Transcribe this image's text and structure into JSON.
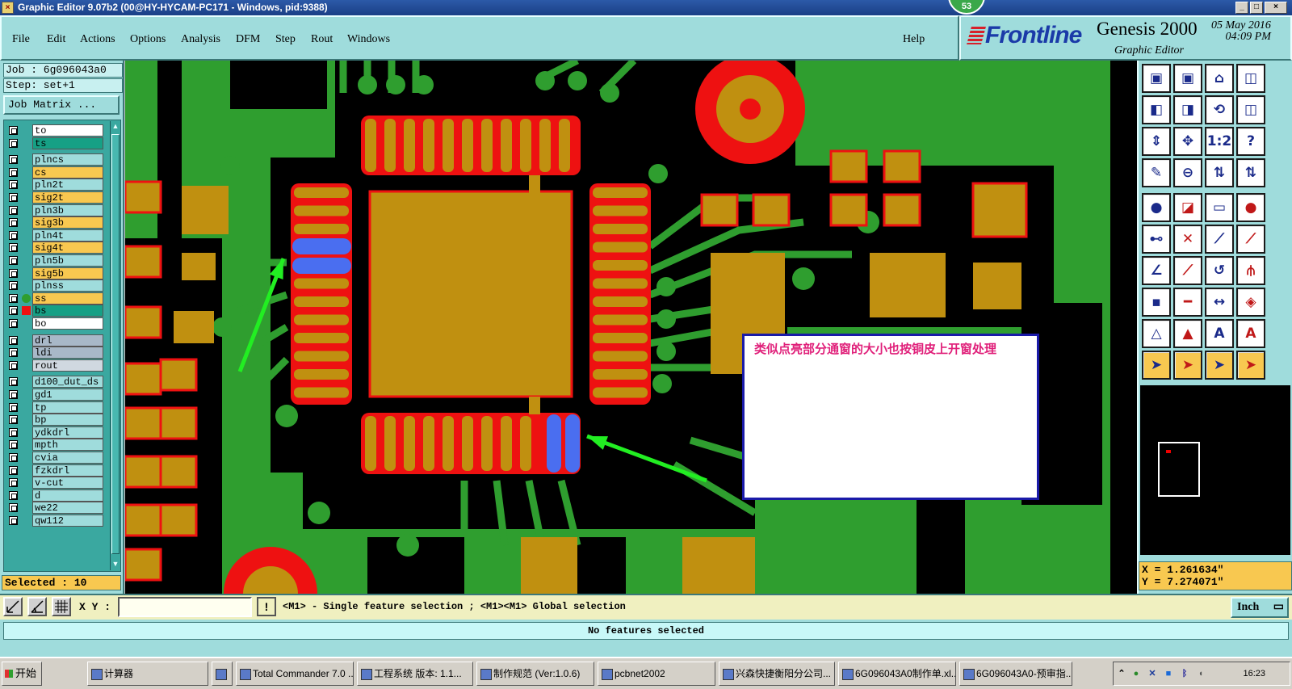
{
  "window": {
    "title": "Graphic Editor 9.07b2 (00@HY-HYCAM-PC171 - Windows, pid:9388)",
    "badge": "53",
    "min_glyph": "_",
    "max_glyph": "□",
    "close_glyph": "×"
  },
  "menu": {
    "items": [
      "File",
      "Edit",
      "Actions",
      "Options",
      "Analysis",
      "DFM",
      "Step",
      "Rout",
      "Windows"
    ],
    "help": "Help"
  },
  "brand": {
    "logo": "Frontline",
    "product": "Genesis 2000",
    "subtitle": "Graphic Editor",
    "date": "05 May 2016",
    "time": "04:09 PM"
  },
  "job": {
    "job_line": "Job : 6g096043a0",
    "step_line": "Step: set+1",
    "matrix_button": "Job Matrix ..."
  },
  "layers": [
    {
      "name": "to",
      "color": "#ffffff",
      "flag": ""
    },
    {
      "name": "ts",
      "color": "#16a085",
      "flag": ""
    },
    {
      "name": "plncs",
      "color": "#9fdcdc",
      "flag": ""
    },
    {
      "name": "cs",
      "color": "#f8c850",
      "flag": ""
    },
    {
      "name": "pln2t",
      "color": "#9fdcdc",
      "flag": ""
    },
    {
      "name": "sig2t",
      "color": "#f8c850",
      "flag": ""
    },
    {
      "name": "pln3b",
      "color": "#9fdcdc",
      "flag": ""
    },
    {
      "name": "sig3b",
      "color": "#f8c850",
      "flag": ""
    },
    {
      "name": "pln4t",
      "color": "#9fdcdc",
      "flag": ""
    },
    {
      "name": "sig4t",
      "color": "#f8c850",
      "flag": ""
    },
    {
      "name": "pln5b",
      "color": "#9fdcdc",
      "flag": ""
    },
    {
      "name": "sig5b",
      "color": "#f8c850",
      "flag": ""
    },
    {
      "name": "plnss",
      "color": "#9fdcdc",
      "flag": ""
    },
    {
      "name": "ss",
      "color": "#f8c850",
      "flag": "green-dot"
    },
    {
      "name": "bs",
      "color": "#16a085",
      "flag": "red-marker"
    },
    {
      "name": "bo",
      "color": "#ffffff",
      "flag": ""
    },
    {
      "name": "drl",
      "color": "#a8b8c8",
      "flag": ""
    },
    {
      "name": "ldi",
      "color": "#a8b8c8",
      "flag": ""
    },
    {
      "name": "rout",
      "color": "#d0d8e0",
      "flag": ""
    },
    {
      "name": "d100_dut_ds",
      "color": "#9fdcdc",
      "flag": ""
    },
    {
      "name": "gd1",
      "color": "#9fdcdc",
      "flag": ""
    },
    {
      "name": "tp",
      "color": "#9fdcdc",
      "flag": ""
    },
    {
      "name": "bp",
      "color": "#9fdcdc",
      "flag": ""
    },
    {
      "name": "ydkdrl",
      "color": "#9fdcdc",
      "flag": ""
    },
    {
      "name": "mpth",
      "color": "#9fdcdc",
      "flag": ""
    },
    {
      "name": "cvia",
      "color": "#9fdcdc",
      "flag": ""
    },
    {
      "name": "fzkdrl",
      "color": "#9fdcdc",
      "flag": ""
    },
    {
      "name": "v-cut",
      "color": "#9fdcdc",
      "flag": ""
    },
    {
      "name": "d",
      "color": "#9fdcdc",
      "flag": ""
    },
    {
      "name": "we22",
      "color": "#9fdcdc",
      "flag": ""
    },
    {
      "name": "qw112",
      "color": "#9fdcdc",
      "flag": ""
    }
  ],
  "selected_label": "Selected : 10",
  "annotation": "类似点亮部分通窗的大小也按铜皮上开窗处理",
  "coords": {
    "x": "X = 1.261634\"",
    "y": "Y = 7.274071\""
  },
  "command": {
    "xy_label": "X Y :",
    "xy_value": "",
    "warn": "!",
    "hint": "<M1> - Single feature selection ; <M1><M1> Global selection",
    "unit": "Inch"
  },
  "status": "No features selected",
  "taskbar": {
    "start": "开始",
    "tasks": [
      "计算器",
      "",
      "Total Commander 7.0 ...",
      "工程系统  版本: 1.1...",
      "制作规范 (Ver:1.0.6)",
      "pcbnet2002",
      "兴森快捷衡阳分公司...",
      "6G096043A0制作单.xl...",
      "6G096043A0-预审指..."
    ],
    "clock": "16:23"
  },
  "colors": {
    "board": "#2f9e2f",
    "pad": "#c09010",
    "smask": "#ee1111",
    "selected": "#4a6ef0",
    "arrow": "#22ee22"
  }
}
